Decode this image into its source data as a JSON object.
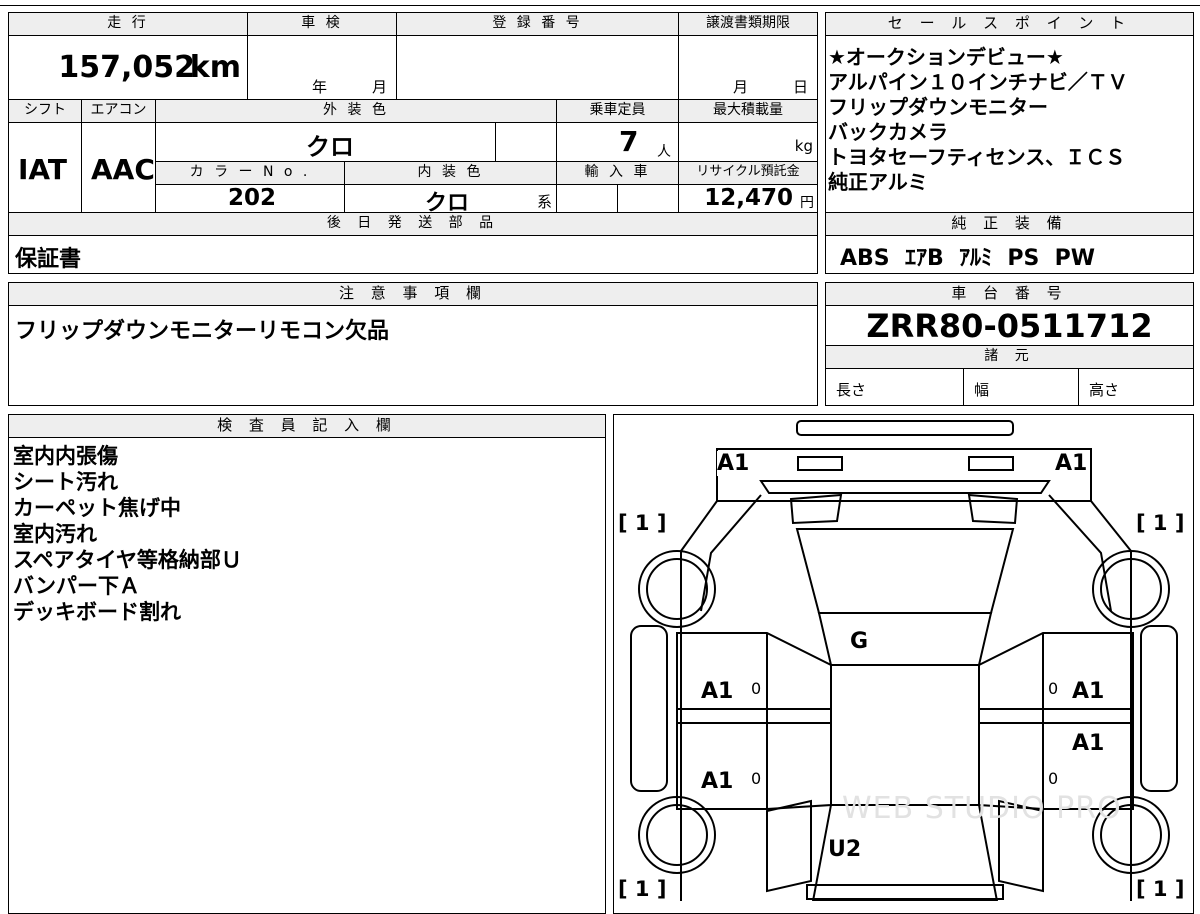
{
  "vehicle": {
    "mileage_label": "走 行",
    "mileage_value": "157,052",
    "mileage_unit": "km",
    "inspection_label": "車 検",
    "inspection_year_unit": "年",
    "inspection_month_unit": "月",
    "registration_label": "登 録 番 号",
    "transfer_label": "譲渡書類期限",
    "transfer_month_unit": "月",
    "transfer_day_unit": "日",
    "shift_label": "シフト",
    "shift_value": "IAT",
    "aircon_label": "エアコン",
    "aircon_value": "AAC",
    "exterior_color_label": "外 装 色",
    "exterior_color_value": "クロ",
    "capacity_label": "乗車定員",
    "capacity_value": "7",
    "capacity_unit": "人",
    "max_load_label": "最大積載量",
    "max_load_unit": "kg",
    "color_no_label": "カ ラ ー N o .",
    "color_no_value": "202",
    "interior_color_label": "内 装 色",
    "interior_color_value": "クロ",
    "interior_color_unit": "系",
    "import_label": "輸 入 車",
    "recycle_label": "リサイクル預託金",
    "recycle_value": "12,470",
    "recycle_unit": "円"
  },
  "sales_points": {
    "header": "セ ー ル ス ポ イ ン ト",
    "items": [
      "★オークションデビュー★",
      "アルパイン１０インチナビ／ＴＶ",
      "フリップダウンモニター",
      "バックカメラ",
      "トヨタセーフティセンス、ＩＣＳ",
      "純正アルミ"
    ]
  },
  "later_parts": {
    "header": "後 日 発 送 部 品",
    "value": "保証書"
  },
  "standard_equipment": {
    "header": "純 正 装 備",
    "value": "ABS  ｴｱB  ｱﾙﾐ  PS  PW"
  },
  "notes": {
    "header": "注 意 事 項 欄",
    "value": "フリップダウンモニターリモコン欠品"
  },
  "chassis": {
    "header": "車 台 番 号",
    "value": "ZRR80-0511712"
  },
  "specs": {
    "header": "諸 元",
    "length_label": "長さ",
    "width_label": "幅",
    "height_label": "高さ"
  },
  "inspector": {
    "header": "検 査 員 記 入 欄",
    "items": [
      "室内内張傷",
      "シート汚れ",
      "カーペット焦げ中",
      "室内汚れ",
      "スペアタイヤ等格納部Ｕ",
      "バンパー下Ａ",
      "デッキボード割れ"
    ]
  },
  "diagram": {
    "front_left": "A1",
    "front_right": "A1",
    "tire_front_left": "[ 1 ]",
    "tire_front_right": "[ 1 ]",
    "tire_rear_left": "[ 1 ]",
    "tire_rear_right": "[ 1 ]",
    "roof": "G",
    "left_front_door": "A1",
    "left_rear_door": "A1",
    "right_front_door": "A1",
    "right_rear_door": "A1",
    "door_zero": "0",
    "rear": "U2",
    "watermark": "WEB STUDIO PRO"
  }
}
